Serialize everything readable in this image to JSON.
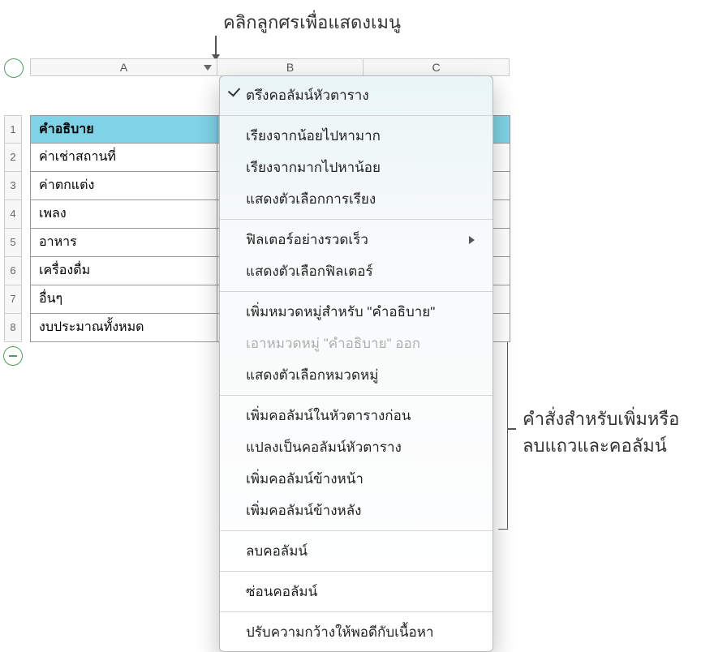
{
  "callouts": {
    "top": "คลิกลูกศรเพื่อแสดงเมนู",
    "right_line1": "คำสั่งสำหรับเพิ่มหรือ",
    "right_line2": "ลบแถวและคอลัมน์"
  },
  "columns": [
    "A",
    "B",
    "C"
  ],
  "row_numbers": [
    "1",
    "2",
    "3",
    "4",
    "5",
    "6",
    "7",
    "8"
  ],
  "cells": [
    "คำอธิบาย",
    "ค่าเช่าสถานที่",
    "ค่าตกแต่ง",
    "เพลง",
    "อาหาร",
    "เครื่องดื่ม",
    "อื่นๆ",
    "งบประมาณทั้งหมด"
  ],
  "menu": {
    "freeze_header": "ตรึงคอลัมน์หัวตาราง",
    "sort_asc": "เรียงจากน้อยไปหามาก",
    "sort_desc": "เรียงจากมากไปหาน้อย",
    "sort_options": "แสดงตัวเลือกการเรียง",
    "quick_filter": "ฟิลเตอร์อย่างรวดเร็ว",
    "filter_options": "แสดงตัวเลือกฟิลเตอร์",
    "add_category": "เพิ่มหมวดหมู่สำหรับ \"คำอธิบาย\"",
    "remove_category": "เอาหมวดหมู่ \"คำอธิบาย\" ออก",
    "category_options": "แสดงตัวเลือกหมวดหมู่",
    "add_header_before": "เพิ่มคอลัมน์ในหัวตารางก่อน",
    "convert_header": "แปลงเป็นคอลัมน์หัวตาราง",
    "add_col_before": "เพิ่มคอลัมน์ข้างหน้า",
    "add_col_after": "เพิ่มคอลัมน์ข้างหลัง",
    "delete_col": "ลบคอลัมน์",
    "hide_col": "ซ่อนคอลัมน์",
    "fit_width": "ปรับความกว้างให้พอดีกับเนื้อหา"
  }
}
